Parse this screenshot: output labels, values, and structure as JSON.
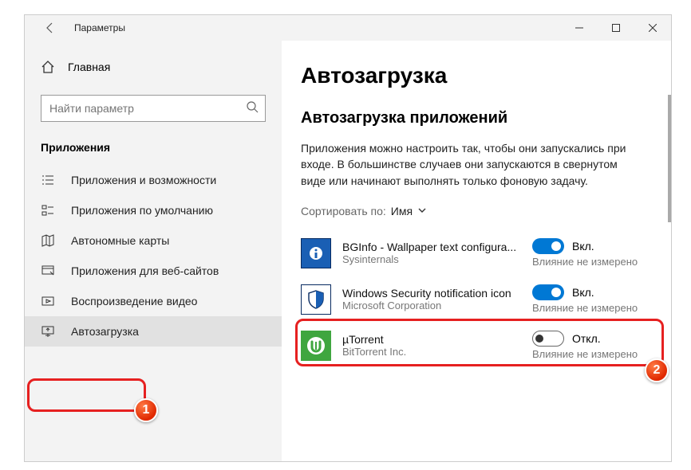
{
  "titlebar": {
    "title": "Параметры"
  },
  "sidebar": {
    "home": "Главная",
    "search_placeholder": "Найти параметр",
    "section": "Приложения",
    "items": [
      {
        "label": "Приложения и возможности"
      },
      {
        "label": "Приложения по умолчанию"
      },
      {
        "label": "Автономные карты"
      },
      {
        "label": "Приложения для веб-сайтов"
      },
      {
        "label": "Воспроизведение видео"
      },
      {
        "label": "Автозагрузка"
      }
    ]
  },
  "main": {
    "title": "Автозагрузка",
    "subtitle": "Автозагрузка приложений",
    "description": "Приложения можно настроить так, чтобы они запускались при входе. В большинстве случаев они запускаются в свернутом виде или начинают выполнять только фоновую задачу.",
    "sort_label": "Сортировать по:",
    "sort_value": "Имя",
    "toggle_on": "Вкл.",
    "toggle_off": "Откл.",
    "impact": "Влияние не измерено",
    "apps": [
      {
        "name": "BGInfo - Wallpaper text configura...",
        "publisher": "Sysinternals",
        "on": true
      },
      {
        "name": "Windows Security notification icon",
        "publisher": "Microsoft Corporation",
        "on": true
      },
      {
        "name": "µTorrent",
        "publisher": "BitTorrent Inc.",
        "on": false
      }
    ]
  },
  "annotations": {
    "badge1": "1",
    "badge2": "2"
  }
}
